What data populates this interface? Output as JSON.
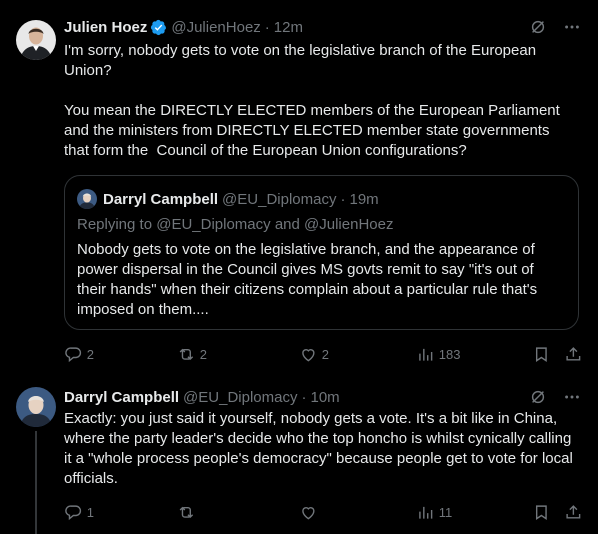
{
  "colors": {
    "background": "#000000",
    "text_primary": "#e7e9ea",
    "text_secondary": "#71767b",
    "border": "#2f3336",
    "verified_blue": "#1d9bf0"
  },
  "tweet1": {
    "author": {
      "name": "Julien Hoez",
      "handle": "@JulienHoez",
      "verified": true
    },
    "separator": "·",
    "time": "12m",
    "text": "I'm sorry, nobody gets to vote on the legislative branch of the European Union?\n\nYou mean the DIRECTLY ELECTED members of the European Parliament and the ministers from DIRECTLY ELECTED member state governments that form the  Council of the European Union configurations?",
    "quote": {
      "author": {
        "name": "Darryl Campbell",
        "handle": "@EU_Diplomacy"
      },
      "separator": "·",
      "time": "19m",
      "reply_prefix": "Replying to",
      "reply_to_1": "@EU_Diplomacy",
      "reply_and": "and",
      "reply_to_2": "@JulienHoez",
      "text": "Nobody gets to vote on the legislative branch, and the appearance of power dispersal in the Council gives MS govts remit to say \"it's out of their hands\" when their citizens complain about a particular rule that's imposed on them...."
    },
    "actions": {
      "replies": "2",
      "reposts": "2",
      "likes": "2",
      "views": "183"
    }
  },
  "tweet2": {
    "author": {
      "name": "Darryl Campbell",
      "handle": "@EU_Diplomacy"
    },
    "separator": "·",
    "time": "10m",
    "text": "Exactly: you just said it yourself, nobody gets a vote. It's a bit like in China, where the party leader's decide who the top honcho is whilst cynically calling it a \"whole process people's democracy\" because people get to vote for local officials.",
    "actions": {
      "replies": "1",
      "reposts": "",
      "likes": "",
      "views": "11"
    }
  },
  "icons": {
    "verified": "verified-badge-icon",
    "grok": "grok-icon",
    "more": "more-options-icon",
    "reply": "reply-icon",
    "repost": "repost-icon",
    "like": "like-icon",
    "views": "views-icon",
    "bookmark": "bookmark-icon",
    "share": "share-icon"
  }
}
